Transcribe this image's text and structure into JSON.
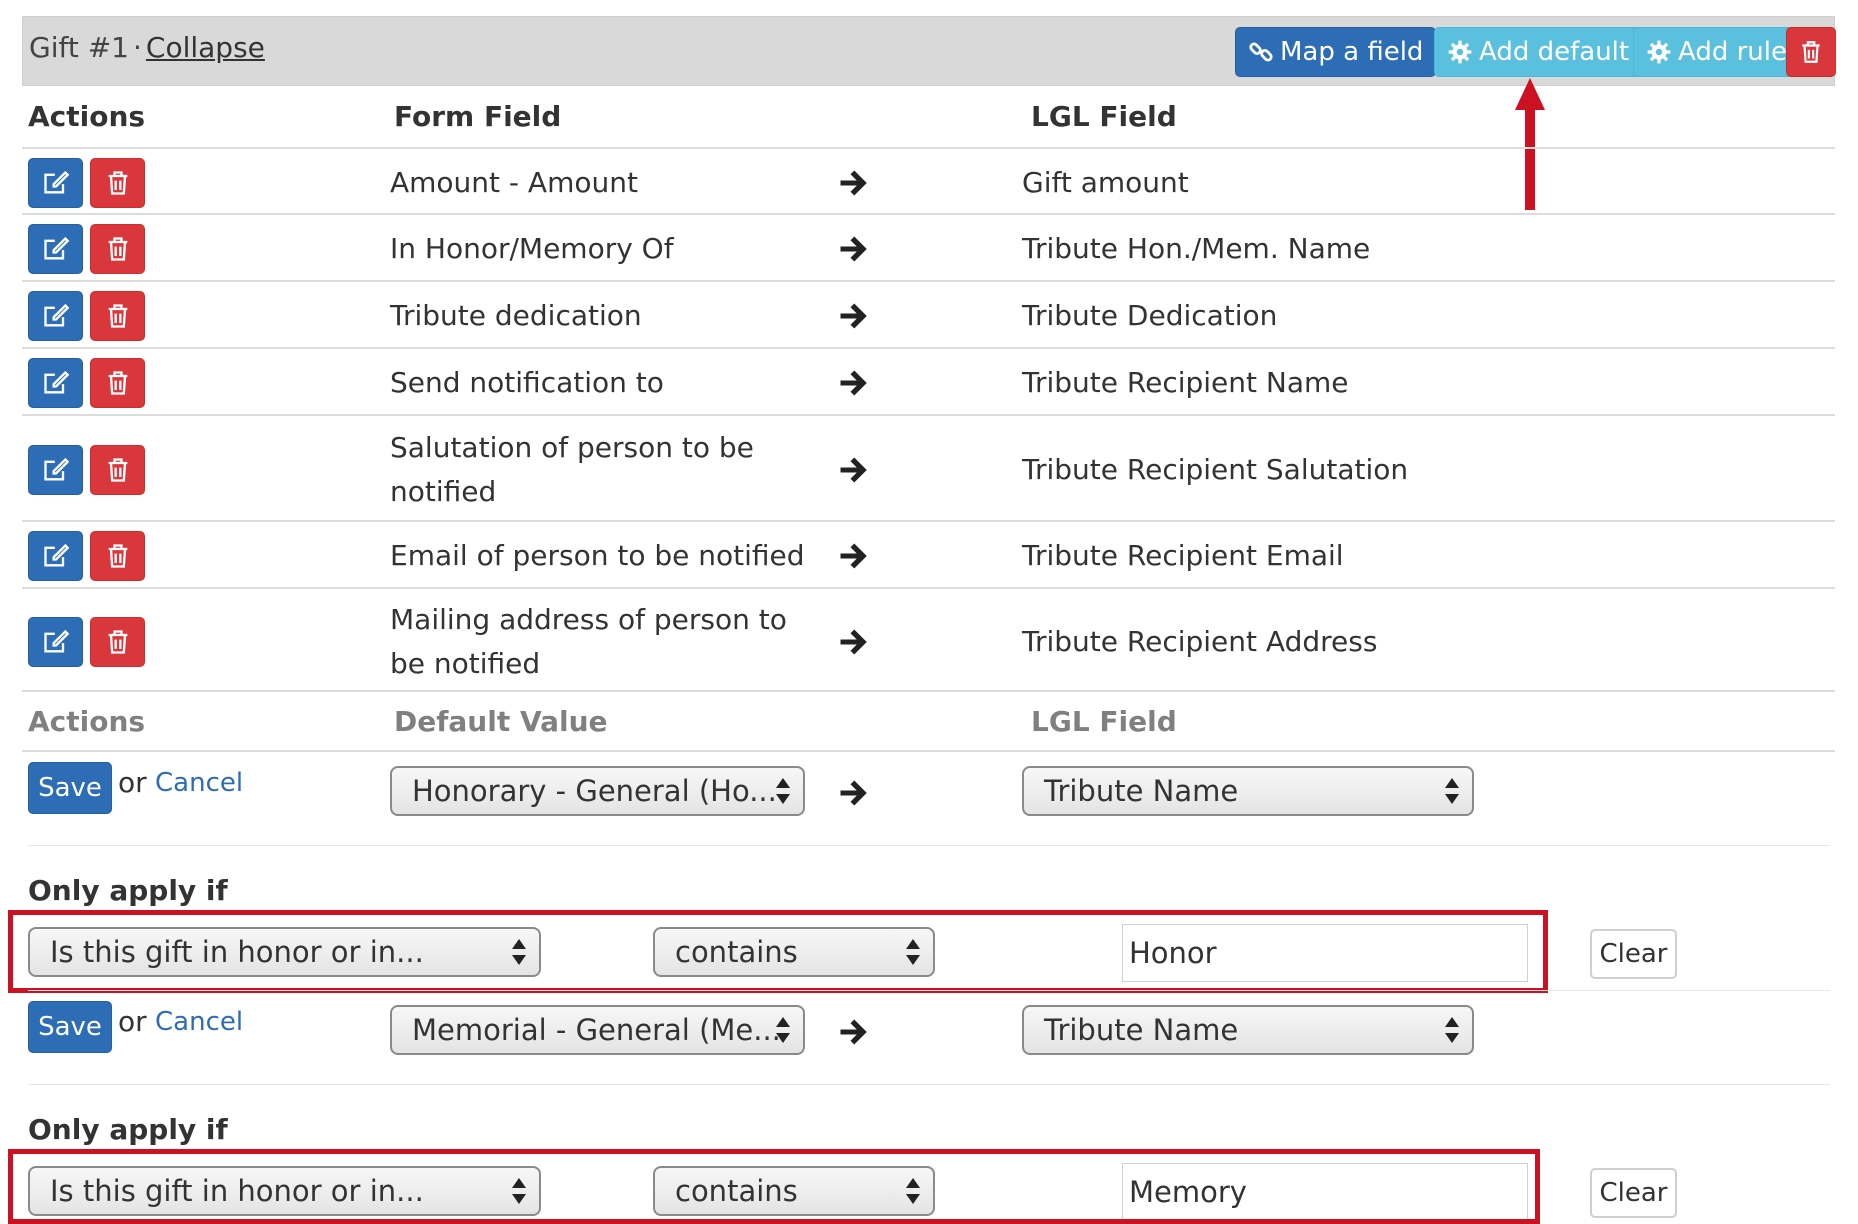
{
  "header": {
    "gift_label": "Gift #1",
    "separator": "·",
    "collapse_link": "Collapse",
    "map_field_button": "Map a field",
    "add_default_button": "Add default",
    "add_rule_button": "Add rule"
  },
  "mapping_table": {
    "columns": {
      "actions": "Actions",
      "form_field": "Form Field",
      "lgl_field": "LGL Field"
    },
    "rows": [
      {
        "form_field": "Amount - Amount",
        "lgl_field": "Gift amount"
      },
      {
        "form_field": "In Honor/Memory Of",
        "lgl_field": "Tribute Hon./Mem. Name"
      },
      {
        "form_field": "Tribute dedication",
        "lgl_field": "Tribute Dedication"
      },
      {
        "form_field": "Send notification to",
        "lgl_field": "Tribute Recipient Name"
      },
      {
        "form_field": "Salutation of person to be notified",
        "lgl_field": "Tribute Recipient Salutation"
      },
      {
        "form_field": "Email of person to be notified",
        "lgl_field": "Tribute Recipient Email"
      },
      {
        "form_field": "Mailing address of person to be notified",
        "lgl_field": "Tribute Recipient Address"
      }
    ]
  },
  "defaults_table": {
    "columns": {
      "actions": "Actions",
      "default_value": "Default Value",
      "lgl_field": "LGL Field"
    },
    "rows": [
      {
        "save_label": "Save",
        "or_label": "or",
        "cancel_label": "Cancel",
        "default_value": "Honorary - General (Ho...",
        "lgl_field": "Tribute Name",
        "only_apply_label": "Only apply if",
        "condition_field": "Is this gift in honor or in...",
        "condition_operator": "contains",
        "condition_value": "Honor",
        "clear_label": "Clear"
      },
      {
        "save_label": "Save",
        "or_label": "or",
        "cancel_label": "Cancel",
        "default_value": "Memorial - General (Me...",
        "lgl_field": "Tribute Name",
        "only_apply_label": "Only apply if",
        "condition_field": "Is this gift in honor or in...",
        "condition_operator": "contains",
        "condition_value": "Memory",
        "clear_label": "Clear"
      }
    ]
  },
  "colors": {
    "primary": "#2c6db5",
    "info": "#5bc0de",
    "danger": "#d9373c",
    "annotation": "#cc1122",
    "header_bg": "#d9d9d9"
  },
  "icons": {
    "map": "link-icon",
    "default": "gear-icon",
    "rule": "gear-icon",
    "delete": "trash-icon",
    "edit": "edit-icon",
    "arrow": "arrow-right-icon",
    "select": "select-caret-icon"
  }
}
